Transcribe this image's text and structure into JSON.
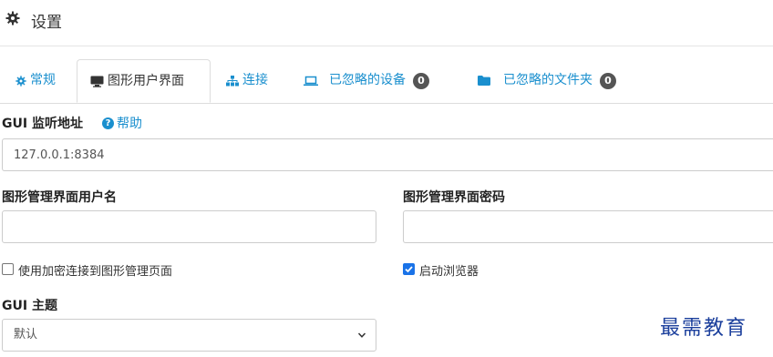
{
  "header": {
    "title": "设置",
    "icon": "gear-icon"
  },
  "tabs": [
    {
      "label": "常规",
      "icon": "gear-icon",
      "active": false
    },
    {
      "label": "图形用户界面",
      "icon": "monitor-icon",
      "active": true
    },
    {
      "label": "连接",
      "icon": "sitemap-icon",
      "active": false
    },
    {
      "label": "已忽略的设备",
      "icon": "laptop-icon",
      "badge": "0",
      "active": false
    },
    {
      "label": "已忽略的文件夹",
      "icon": "folder-icon",
      "badge": "0",
      "active": false
    }
  ],
  "form": {
    "gui_address_label": "GUI 监听地址",
    "help_label": "帮助",
    "gui_address_value": "127.0.0.1:8384",
    "username_label": "图形管理界面用户名",
    "username_value": "",
    "password_label": "图形管理界面密码",
    "password_value": "",
    "use_tls_label": "使用加密连接到图形管理页面",
    "use_tls_checked": false,
    "start_browser_label": "启动浏览器",
    "start_browser_checked": true,
    "theme_label": "GUI 主题",
    "theme_selected": "默认"
  },
  "watermark": "最需教育",
  "colors": {
    "link": "#1a8fce",
    "badge": "#555555",
    "checkbox_on": "#1a73e8",
    "watermark": "#1b3f9c"
  }
}
